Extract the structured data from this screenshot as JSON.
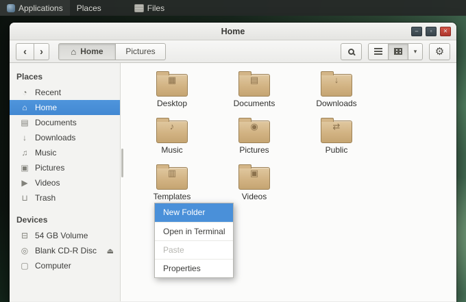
{
  "colors": {
    "selection_blue": "#4a90d9",
    "folder_tan": "#d2b383",
    "panel_dark": "#262a28",
    "close_red": "#c0443a"
  },
  "topbar": {
    "menus": [
      {
        "label": "Applications"
      },
      {
        "label": "Places"
      }
    ],
    "app": {
      "label": "Files",
      "icon": "files-icon"
    }
  },
  "window": {
    "title": "Home",
    "controls": [
      {
        "name": "minimize",
        "glyph": "–"
      },
      {
        "name": "maximize",
        "glyph": "▫"
      },
      {
        "name": "close",
        "glyph": "✕"
      }
    ]
  },
  "toolbar": {
    "back_glyph": "‹",
    "forward_glyph": "›",
    "home_glyph": "⌂",
    "breadcrumbs": [
      {
        "label": "Home",
        "active": true
      },
      {
        "label": "Pictures",
        "active": false
      }
    ],
    "view_chevron": "▾",
    "gear_glyph": "⚙"
  },
  "sidebar": {
    "eject_glyph": "⏏",
    "sections": [
      {
        "heading": "Places",
        "items": [
          {
            "label": "Recent",
            "icon": "recent-icon",
            "glyph": "◔"
          },
          {
            "label": "Home",
            "icon": "home-icon",
            "glyph": "⌂",
            "selected": true
          },
          {
            "label": "Documents",
            "icon": "documents-icon",
            "glyph": "▤"
          },
          {
            "label": "Downloads",
            "icon": "downloads-icon",
            "glyph": "↓"
          },
          {
            "label": "Music",
            "icon": "music-icon",
            "glyph": "♫"
          },
          {
            "label": "Pictures",
            "icon": "pictures-icon",
            "glyph": "▣"
          },
          {
            "label": "Videos",
            "icon": "videos-icon",
            "glyph": "▶"
          },
          {
            "label": "Trash",
            "icon": "trash-icon",
            "glyph": "⊔"
          }
        ]
      },
      {
        "heading": "Devices",
        "items": [
          {
            "label": "54 GB Volume",
            "icon": "harddisk-icon",
            "glyph": "⊟"
          },
          {
            "label": "Blank CD-R Disc",
            "icon": "optical-disc-icon",
            "glyph": "◎",
            "eject": true
          },
          {
            "label": "Computer",
            "icon": "computer-icon",
            "glyph": "▢"
          }
        ]
      }
    ]
  },
  "files": [
    {
      "label": "Desktop",
      "emblem": "▦"
    },
    {
      "label": "Documents",
      "emblem": "▤"
    },
    {
      "label": "Downloads",
      "emblem": "↓"
    },
    {
      "label": "Music",
      "emblem": "♪"
    },
    {
      "label": "Pictures",
      "emblem": "◉"
    },
    {
      "label": "Public",
      "emblem": "⇄"
    },
    {
      "label": "Templates",
      "emblem": "▥"
    },
    {
      "label": "Videos",
      "emblem": "▣"
    }
  ],
  "context_menu": {
    "items": [
      {
        "label": "New Folder",
        "state": "highlighted"
      },
      {
        "label": "Open in Terminal",
        "state": "normal"
      },
      {
        "label": "Paste",
        "state": "disabled"
      },
      {
        "label": "Properties",
        "state": "normal"
      }
    ]
  }
}
